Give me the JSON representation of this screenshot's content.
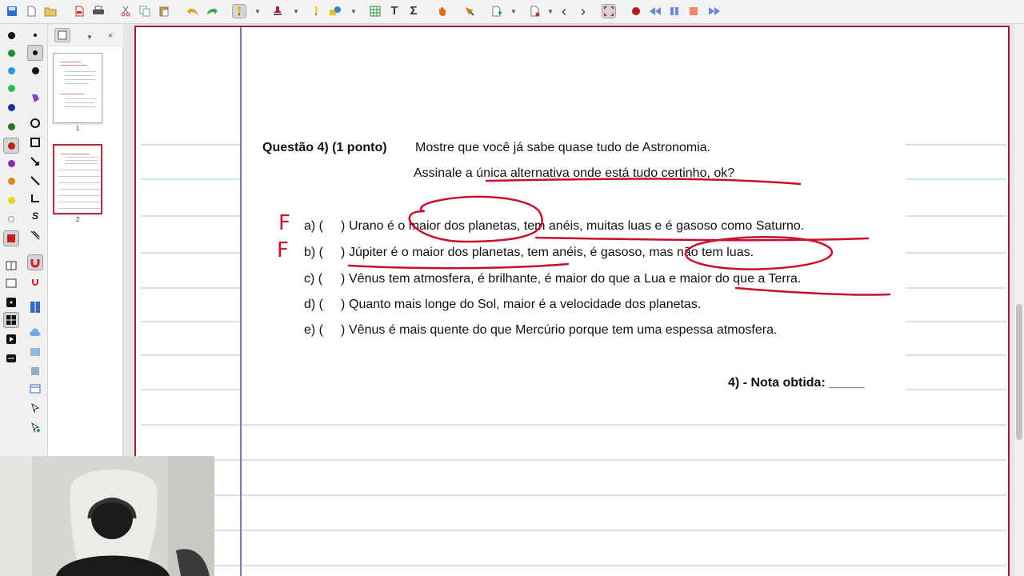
{
  "toolbar": {
    "icons": [
      "save-icon",
      "new-page-icon",
      "open-icon",
      "pdf-icon",
      "print-icon",
      "cut-icon",
      "copy-icon",
      "paste-icon",
      "undo-icon",
      "redo-icon",
      "pen-icon",
      "stamp-icon",
      "highlighter-icon",
      "shapes-icon",
      "table-icon",
      "text-icon",
      "sigma-icon",
      "hand-icon",
      "select-icon",
      "insert-icon",
      "delete-page-icon",
      "prev-icon",
      "next-icon",
      "fullscreen-icon",
      "record-icon",
      "rewind-icon",
      "pause-icon",
      "stop-icon",
      "forward-icon"
    ],
    "nav_prev": "‹",
    "nav_next": "›",
    "text_tool": "T",
    "sigma_tool": "Σ"
  },
  "palette": {
    "colors": [
      "#111111",
      "#1a8f2f",
      "#2a9bd8",
      "#2ebd54",
      "#1a2fa0",
      "#2d6e2d",
      "#c21f1f",
      "#8a2bb8",
      "#e08a1a",
      "#e8d21a",
      "#ffffff",
      "#c21f1f"
    ],
    "tools": [
      "eraser-icon",
      "dot-small-icon",
      "dot-large-icon",
      "fill-icon",
      "circle-icon",
      "square-icon",
      "arrow-icon",
      "line-icon",
      "angle-icon",
      "s-tool-icon",
      "tweezers-icon"
    ]
  },
  "sorter": {
    "pages": [
      {
        "number": "1",
        "selected": false
      },
      {
        "number": "2",
        "selected": true
      }
    ]
  },
  "document": {
    "question_bold": "Questão 4) (1 ponto)",
    "question_text": "Mostre que você já sabe quase tudo de Astronomia.",
    "instruction": "Assinale a única alternativa onde está tudo certinho, ok?",
    "options": [
      {
        "letter": "a) (",
        "close": ")",
        "text": "Urano é o maior dos planetas, tem anéis, muitas luas e é gasoso como Saturno."
      },
      {
        "letter": "b) (",
        "close": ")",
        "text": "Júpiter é o maior dos planetas, tem anéis, é gasoso, mas não tem luas."
      },
      {
        "letter": "c) (",
        "close": ")",
        "text": "Vênus tem atmosfera, é brilhante, é maior do que a Lua e maior do que a Terra."
      },
      {
        "letter": "d) (",
        "close": ")",
        "text": "Quanto mais longe do Sol, maior é a velocidade dos planetas."
      },
      {
        "letter": "e) (",
        "close": ")",
        "text": "Vênus é mais quente do que Mercúrio porque tem uma espessa atmosfera."
      }
    ],
    "grade_label": "4) - Nota obtida: _____",
    "annotation_a": "F",
    "annotation_b": "F",
    "ink_color": "#c8102e"
  }
}
